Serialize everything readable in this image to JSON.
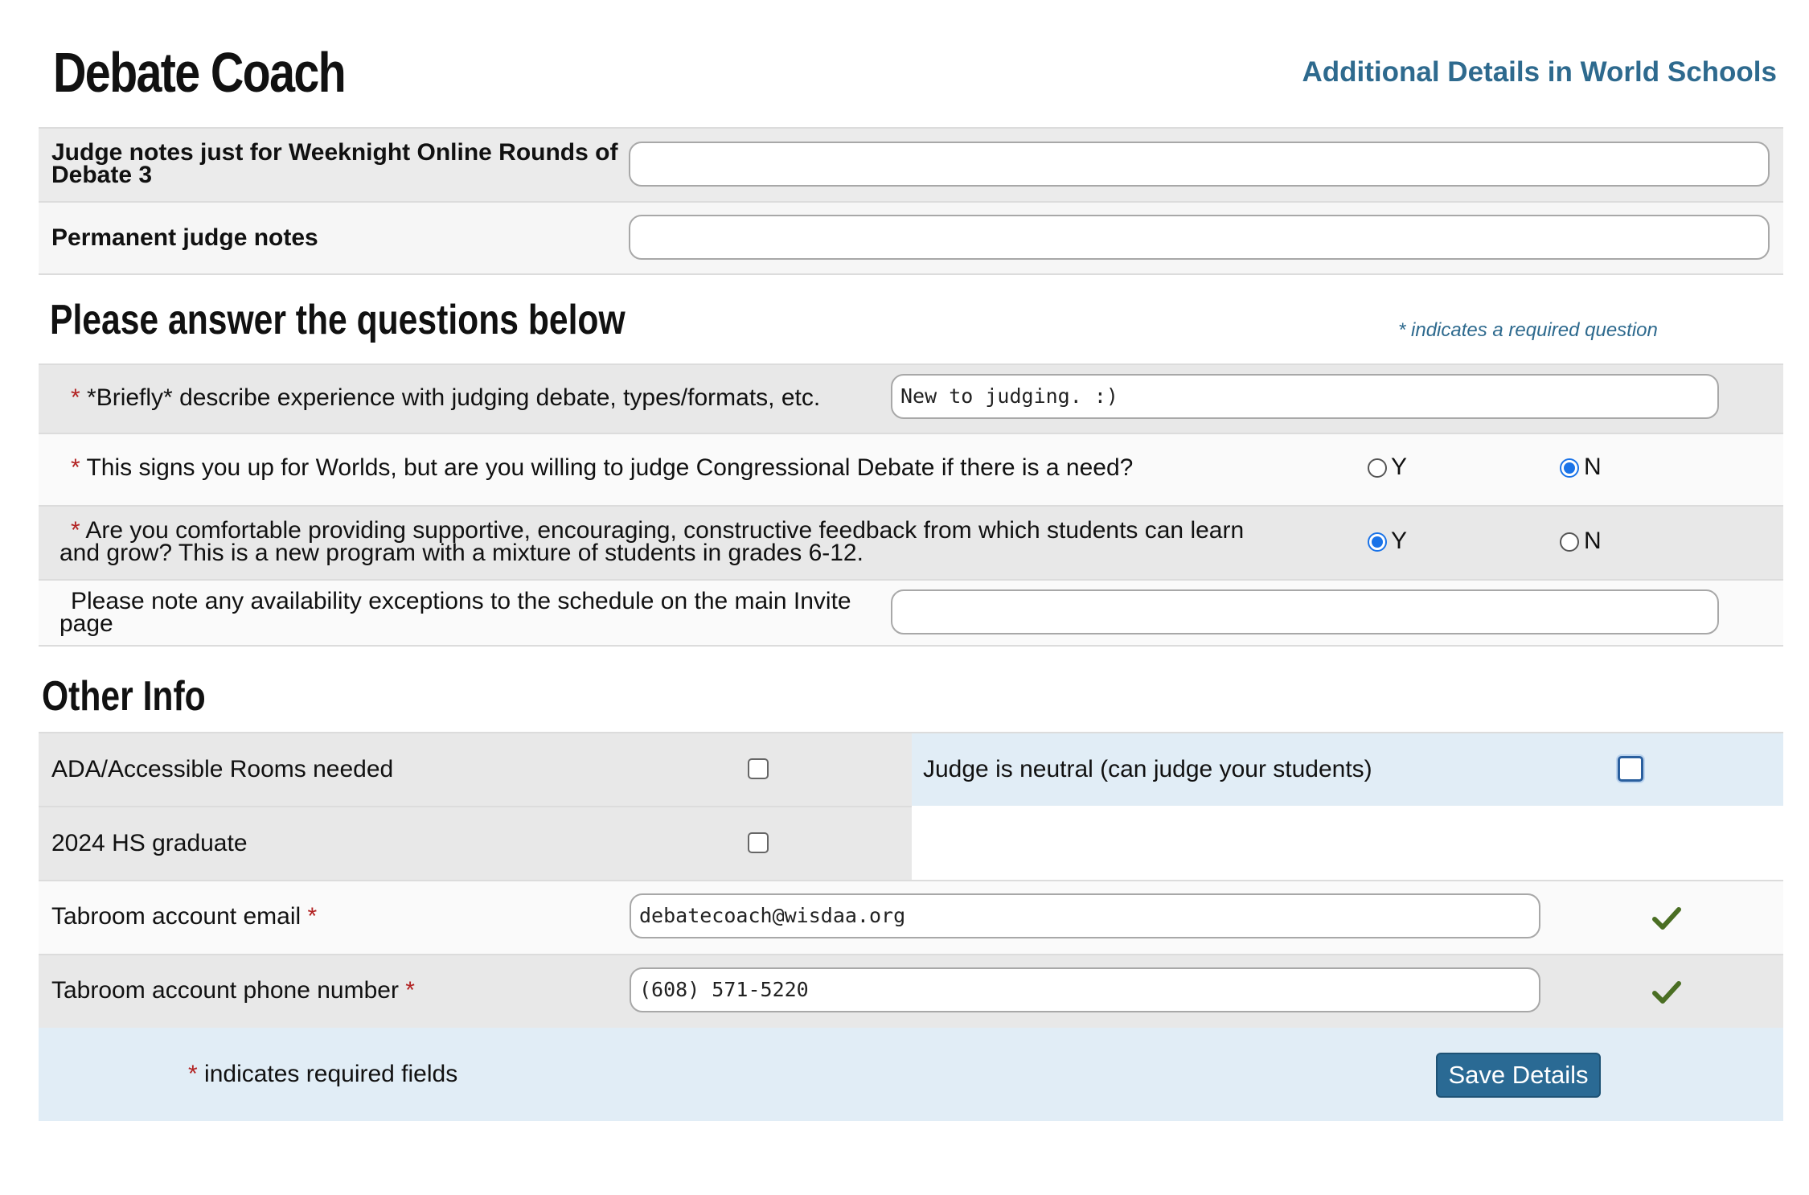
{
  "header": {
    "title": "Debate Coach",
    "link": "Additional Details in World Schools"
  },
  "judge_notes": {
    "weeknight_label_line1": "Judge notes just for Weeknight Online Rounds of",
    "weeknight_label_line2": "Debate 3",
    "weeknight_value": "",
    "permanent_label": "Permanent judge notes",
    "permanent_value": ""
  },
  "questions": {
    "heading": "Please answer the questions below",
    "required_note": "* indicates a required question",
    "q1": {
      "required": "*",
      "text": "*Briefly* describe experience with judging debate, types/formats, etc.",
      "value": "New to judging. :)"
    },
    "q2": {
      "required": "*",
      "text": "This signs you up for Worlds, but are you willing to judge Congressional Debate if there is a need?",
      "options": [
        "Y",
        "N"
      ],
      "selected": "N"
    },
    "q3": {
      "required": "*",
      "text_line1": "Are you comfortable providing supportive, encouraging, constructive feedback from which students can learn",
      "text_line2": "and grow? This is a new program with a mixture of students in grades 6-12.",
      "options": [
        "Y",
        "N"
      ],
      "selected": "Y"
    },
    "q4": {
      "text_line1": "Please note any availability exceptions to the schedule on the main Invite",
      "text_line2": "page",
      "value": ""
    }
  },
  "other_info": {
    "heading": "Other Info",
    "ada_label": "ADA/Accessible Rooms needed",
    "ada_checked": false,
    "neutral_label": "Judge is neutral (can judge your students)",
    "neutral_checked": false,
    "graduate_label": "2024 HS graduate",
    "graduate_checked": false,
    "email_label": "Tabroom account email",
    "email_required": "*",
    "email_value": "debatecoach@wisdaa.org",
    "phone_label": "Tabroom account phone number",
    "phone_required": "*",
    "phone_value": "(608) 571-5220"
  },
  "footer": {
    "required_star": "*",
    "required_text": "indicates required fields",
    "save_label": "Save Details"
  },
  "colors": {
    "accent": "#2a6a94",
    "link": "#2e6a8e",
    "required": "#b22222",
    "check": "#4a6e23",
    "radio_selected": "#1a73e8"
  }
}
